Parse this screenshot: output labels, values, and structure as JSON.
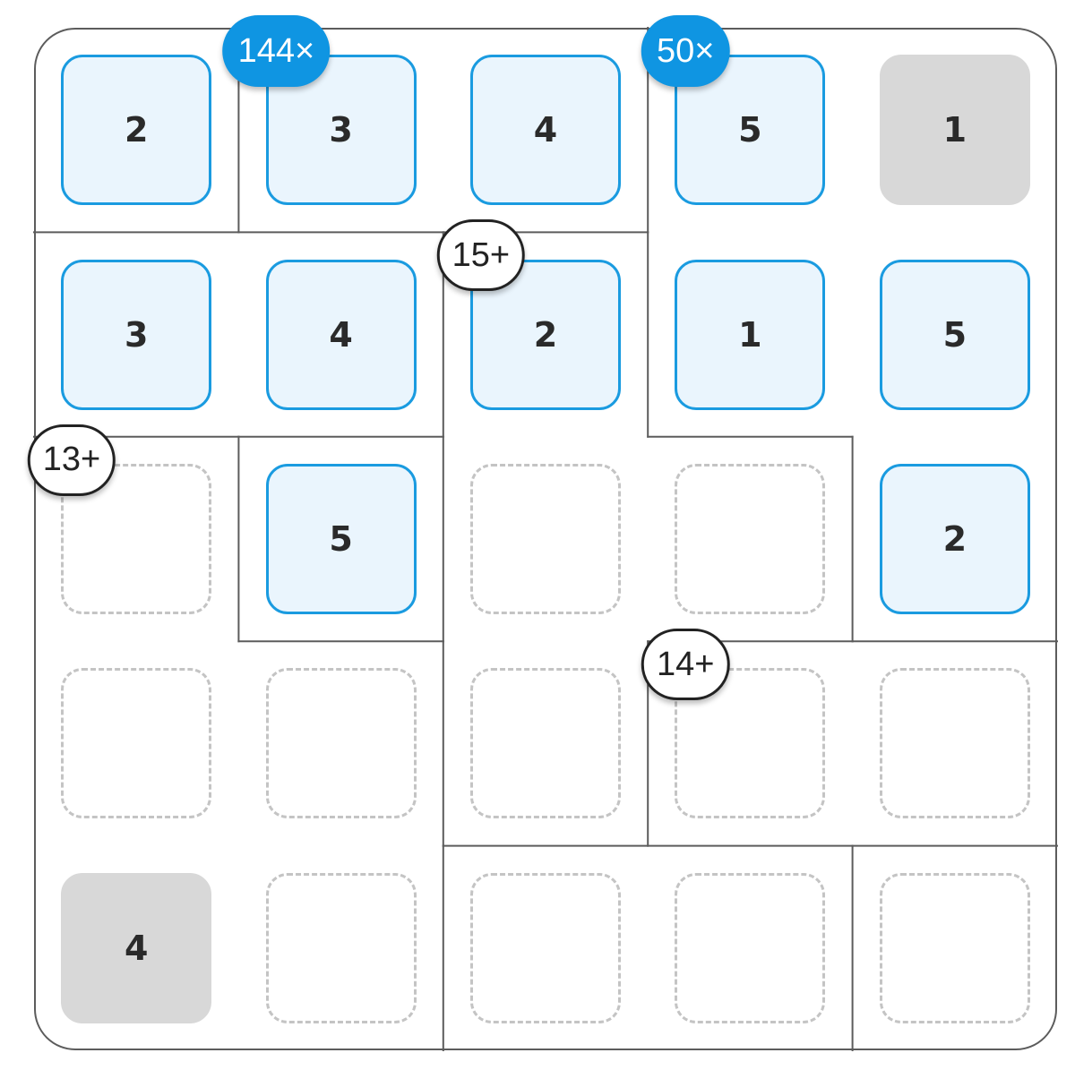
{
  "puzzle": {
    "size": 5,
    "cells": [
      [
        {
          "value": "2",
          "state": "filled"
        },
        {
          "value": "3",
          "state": "filled"
        },
        {
          "value": "4",
          "state": "filled"
        },
        {
          "value": "5",
          "state": "filled"
        },
        {
          "value": "1",
          "state": "given"
        }
      ],
      [
        {
          "value": "3",
          "state": "filled"
        },
        {
          "value": "4",
          "state": "filled"
        },
        {
          "value": "2",
          "state": "filled"
        },
        {
          "value": "1",
          "state": "filled"
        },
        {
          "value": "5",
          "state": "filled"
        }
      ],
      [
        {
          "value": "",
          "state": "empty"
        },
        {
          "value": "5",
          "state": "filled"
        },
        {
          "value": "",
          "state": "empty"
        },
        {
          "value": "",
          "state": "empty"
        },
        {
          "value": "2",
          "state": "filled"
        }
      ],
      [
        {
          "value": "",
          "state": "empty"
        },
        {
          "value": "",
          "state": "empty"
        },
        {
          "value": "",
          "state": "empty"
        },
        {
          "value": "",
          "state": "empty"
        },
        {
          "value": "",
          "state": "empty"
        }
      ],
      [
        {
          "value": "4",
          "state": "given"
        },
        {
          "value": "",
          "state": "empty"
        },
        {
          "value": "",
          "state": "empty"
        },
        {
          "value": "",
          "state": "empty"
        },
        {
          "value": "",
          "state": "empty"
        }
      ]
    ],
    "cage_map": [
      [
        "A",
        "B",
        "B",
        "C",
        "C"
      ],
      [
        "D",
        "D",
        "E",
        "C",
        "C"
      ],
      [
        "F",
        "G",
        "E",
        "E",
        "C"
      ],
      [
        "F",
        "F",
        "E",
        "H",
        "H"
      ],
      [
        "F",
        "F",
        "I",
        "I",
        "J"
      ]
    ],
    "clues": [
      {
        "label": "144×",
        "row": 0,
        "col": 1,
        "style": "done"
      },
      {
        "label": "50×",
        "row": 0,
        "col": 3,
        "style": "done"
      },
      {
        "label": "15+",
        "row": 1,
        "col": 2,
        "style": "open"
      },
      {
        "label": "13+",
        "row": 2,
        "col": 0,
        "style": "open"
      },
      {
        "label": "14+",
        "row": 3,
        "col": 3,
        "style": "open"
      }
    ]
  },
  "colors": {
    "accent": "#1a9be0",
    "badge": "#0f95e2",
    "filled_bg": "#eaf5fd",
    "given_bg": "#d8d8d8",
    "empty_border": "#c4c4c4",
    "cage_line": "#5c5c5c"
  }
}
